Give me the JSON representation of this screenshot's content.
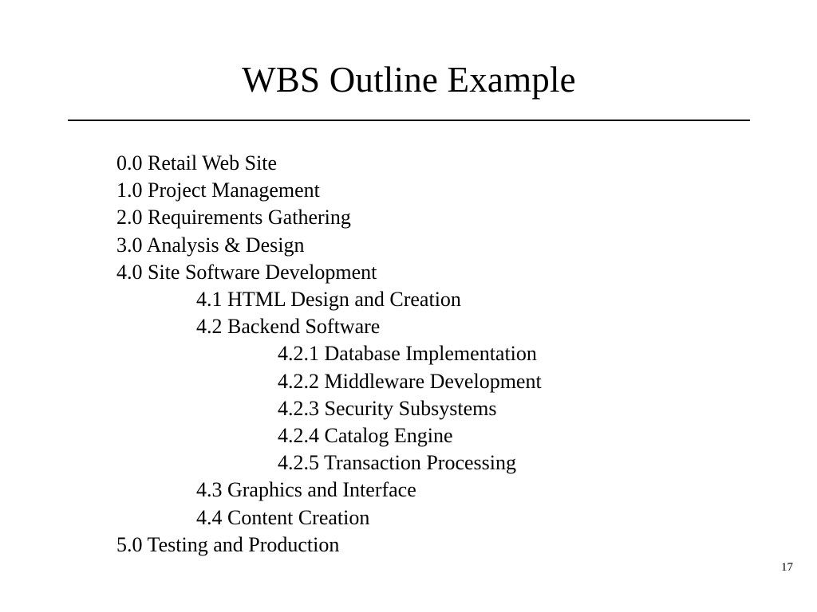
{
  "slide": {
    "title": "WBS Outline Example",
    "page_number": "17",
    "colors": {
      "background": "#ffffff",
      "text": "#000000",
      "rule": "#000000"
    }
  },
  "outline": {
    "items": [
      {
        "text": "0.0 Retail Web Site",
        "level": 0
      },
      {
        "text": "1.0 Project Management",
        "level": 0
      },
      {
        "text": "2.0 Requirements Gathering",
        "level": 0
      },
      {
        "text": "3.0 Analysis & Design",
        "level": 0
      },
      {
        "text": "4.0 Site Software Development",
        "level": 0
      },
      {
        "text": "4.1 HTML Design and Creation",
        "level": 1
      },
      {
        "text": "4.2 Backend Software",
        "level": 1
      },
      {
        "text": "4.2.1 Database Implementation",
        "level": 2
      },
      {
        "text": "4.2.2 Middleware Development",
        "level": 2
      },
      {
        "text": "4.2.3 Security Subsystems",
        "level": 2
      },
      {
        "text": "4.2.4 Catalog Engine",
        "level": 2
      },
      {
        "text": "4.2.5 Transaction Processing",
        "level": 2
      },
      {
        "text": "4.3 Graphics and Interface",
        "level": 1
      },
      {
        "text": "4.4 Content Creation",
        "level": 1
      },
      {
        "text": "5.0 Testing and Production",
        "level": 0
      }
    ]
  }
}
